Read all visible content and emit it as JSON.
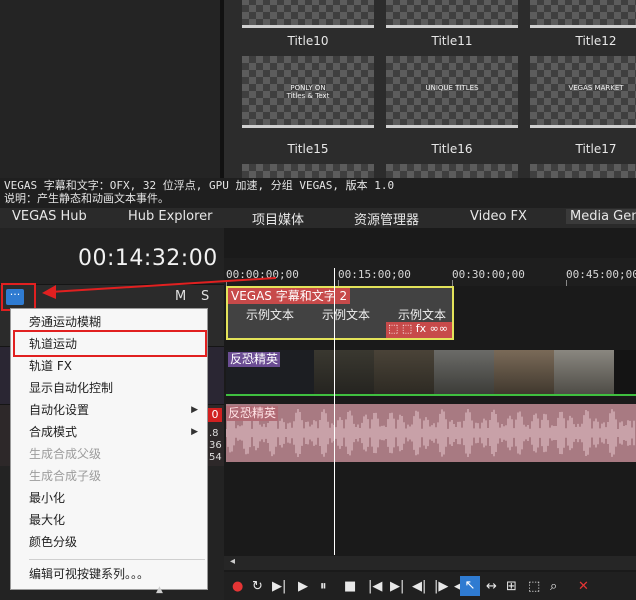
{
  "presets": {
    "row1": [
      "Title10",
      "Title11",
      "Title12"
    ],
    "row2": [
      "Title15",
      "Title16",
      "Title17"
    ],
    "thumb_texts": [
      "PONLY ON\nTitles & Text",
      "UNIQUE TITLES",
      "VEGAS MARKET"
    ]
  },
  "description": {
    "line1": "VEGAS 字幕和文字：OFX, 32 位浮点, GPU 加速, 分组 VEGAS, 版本 1.0",
    "line2": "说明：产生静态和动画文本事件。"
  },
  "tabs": [
    "VEGAS Hub",
    "Hub Explorer",
    "项目媒体",
    "资源管理器",
    "Video FX",
    "Media Gene"
  ],
  "timecode": "00:14:32:00",
  "track_header": {
    "mute": "M",
    "solo": "S",
    "more_button": "···",
    "red_badge": "0",
    "side_numbers": [
      ".8",
      "36",
      "54"
    ]
  },
  "ruler": [
    "00:00:00;00",
    "00:15:00;00",
    "00:30:00;00",
    "00:45:00;00"
  ],
  "text_event": {
    "title": "VEGAS 字幕和文字 2",
    "samples": [
      "示例文本",
      "示例文本",
      "示例文本"
    ],
    "fx": "⬚ ⬚ fx ∞∞"
  },
  "video_track": {
    "label": "反恐精英"
  },
  "audio_track": {
    "label": "反恐精英"
  },
  "context_menu": {
    "items": [
      {
        "label": "旁通运动模糊",
        "disabled": false,
        "submenu": false
      },
      {
        "label": "轨道运动",
        "disabled": false,
        "submenu": false
      },
      {
        "label": "轨道 FX",
        "disabled": false,
        "submenu": false
      },
      {
        "label": "显示自动化控制",
        "disabled": false,
        "submenu": false
      },
      {
        "label": "自动化设置",
        "disabled": false,
        "submenu": true
      },
      {
        "label": "合成模式",
        "disabled": false,
        "submenu": true
      },
      {
        "label": "生成合成父级",
        "disabled": true,
        "submenu": false
      },
      {
        "label": "生成合成子级",
        "disabled": true,
        "submenu": false
      },
      {
        "label": "最小化",
        "disabled": false,
        "submenu": false
      },
      {
        "label": "最大化",
        "disabled": false,
        "submenu": false
      },
      {
        "label": "颜色分级",
        "disabled": false,
        "submenu": false
      },
      {
        "label": "编辑可视按键系列。。。",
        "disabled": false,
        "submenu": false
      }
    ]
  },
  "transport": [
    "●",
    "↻",
    "▶|",
    "▶",
    "⏸",
    "■",
    "|◀",
    "▶|",
    "◀|",
    "|▶",
    "◀▶",
    "↖",
    "↔",
    "⊞",
    "⬚",
    "⌕",
    "✕"
  ],
  "colors": {
    "accent_blue": "#2f7bd1",
    "highlight_red": "#e12020",
    "event_header": "#c74a4a",
    "audio_bg": "#a87a82",
    "video_label": "#6b4d93"
  }
}
